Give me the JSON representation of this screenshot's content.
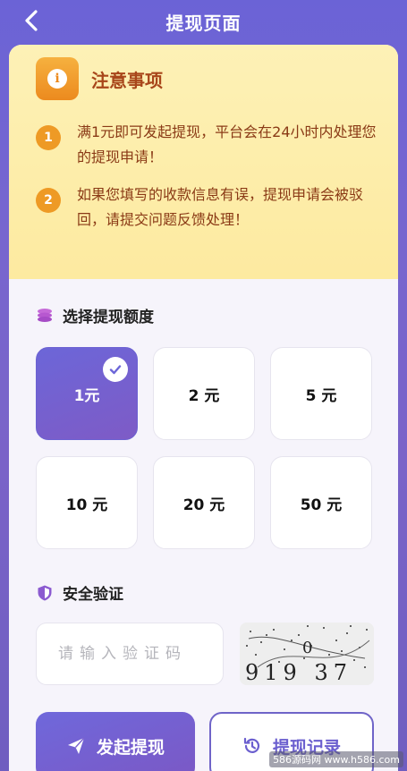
{
  "header": {
    "title": "提现页面"
  },
  "notice": {
    "title": "注意事项",
    "icon_letter": "i",
    "items": [
      {
        "num": "1",
        "text": "满1元即可发起提现，平台会在24小时内处理您的提现申请！"
      },
      {
        "num": "2",
        "text": "如果您填写的收款信息有误，提现申请会被驳回，请提交问题反馈处理！"
      }
    ]
  },
  "amount_section": {
    "title": "选择提现额度",
    "options": [
      "1元",
      "2 元",
      "5 元",
      "10 元",
      "20 元",
      "50 元"
    ],
    "selected_index": 0
  },
  "security": {
    "title": "安全验证",
    "placeholder": "请输入验证码",
    "captcha_text": "919 37"
  },
  "actions": {
    "submit_label": "发起提现",
    "history_label": "提现记录"
  },
  "watermark": "586源码网 www.h586.com",
  "colors": {
    "accent": "#6c66d8",
    "notice_bg": "#fdeaa0",
    "notice_text": "#8a3a16",
    "notice_badge": "#ee9a25"
  }
}
